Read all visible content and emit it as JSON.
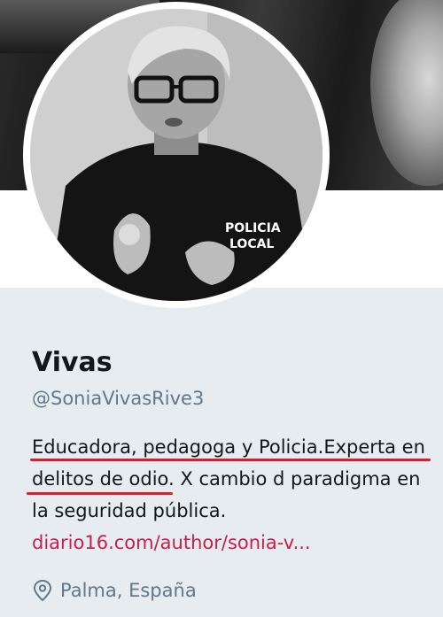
{
  "profile": {
    "name": "Vivas",
    "handle": "@SoniaVivasRive3",
    "bio": {
      "line1": "Educadora, pedagoga y Policia.Experta en",
      "line2": "delitos de odio. X cambio d paradigma en",
      "line3": "la seguridad pública.",
      "link": "diario16.com/author/sonia-v..."
    },
    "location": "Palma, España",
    "avatar_badge_text": "POLICIA LOCAL"
  },
  "colors": {
    "accent_link": "#c81e4b",
    "underline": "#d61f2c",
    "secondary_text": "#657786",
    "primary_text": "#14171a",
    "background": "#e6ecf0"
  }
}
